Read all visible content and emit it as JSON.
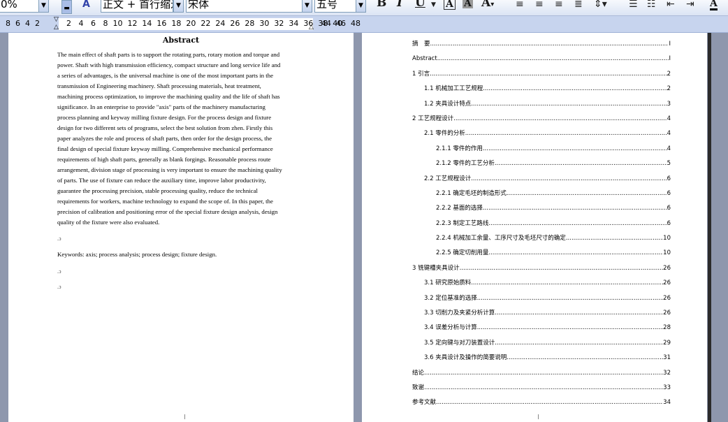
{
  "toolbar": {
    "zoom": "0%",
    "style": "正文 + 首行缩进",
    "font": "宋体",
    "size": "五号",
    "bold": "B",
    "italic": "I",
    "underline": "U",
    "charborder": "A",
    "charshade": "A",
    "fontcolor": "A"
  },
  "ruler": {
    "left_numbers": "8  6  4  2",
    "right_numbers": "2   4   6   8  10  12  14  16  18  20  22  24  26  28  30  32  34  36  38  40",
    "tail_numbers": "44  46  48"
  },
  "abstract": {
    "title": "Abstract",
    "lines": [
      "The main effect of shaft parts is to support the rotating parts, rotary motion and torque and",
      "power. Shaft with high transmission efficiency, compact structure and long service life and",
      "a series of advantages, is the universal machine is one of the most important parts in the",
      "transmission of Engineering machinery. Shaft processing materials, heat treatment,",
      "machining process optimization, to improve the machining quality and the life of shaft has",
      "significance. In an enterprise to provide \"axis\" parts of the machinery manufacturing",
      "process planning and keyway milling fixture design. For the process design and fixture",
      "design for two different sets of programs, select the best solution from zhen. Firstly this",
      "paper analyzes the role and process of shaft parts, then order for the design process, the",
      "final design of special fixture keyway milling. Comprehensive mechanical performance",
      "requirements of high shaft parts, generally as blank forgings. Reasonable process route",
      "arrangement, division stage of processing is very important to ensure the machining quality",
      "of parts. The use of fixture can reduce the auxiliary time, improve labor productivity,",
      "guarantee the processing precision, stable processing quality, reduce the technical",
      "requirements for workers, machine technology to expand the scope of. In this paper, the",
      "precision of calibration and positioning error of the special fixture design analysis, design",
      "quality of the fixture were also evaluated."
    ],
    "keywords": "Keywords: axis; process analysis; process design; fixture design."
  },
  "toc": [
    {
      "label": "摘　要",
      "page": "I",
      "level": 1
    },
    {
      "label": "Abstract",
      "page": "I",
      "level": 1
    },
    {
      "label": "1  引言",
      "page": "2",
      "level": 1
    },
    {
      "label": "1.1 机械加工工艺规程",
      "page": "2",
      "level": 2
    },
    {
      "label": "1.2  夹具设计特点",
      "page": "3",
      "level": 2
    },
    {
      "label": "2  工艺规程设计",
      "page": "4",
      "level": 1
    },
    {
      "label": "2.1  零件的分析",
      "page": "4",
      "level": 2
    },
    {
      "label": "2.1.1  零件的作用",
      "page": "4",
      "level": 3
    },
    {
      "label": "2.1.2  零件的工艺分析",
      "page": "5",
      "level": 3
    },
    {
      "label": "2.2  工艺规程设计",
      "page": "6",
      "level": 2
    },
    {
      "label": "2.2.1  确定毛坯的制造形式",
      "page": "6",
      "level": 3
    },
    {
      "label": "2.2.2  基面的选择",
      "page": "6",
      "level": 3
    },
    {
      "label": "2.2.3  制定工艺路线",
      "page": "6",
      "level": 3
    },
    {
      "label": "2.2.4  机械加工余量、工序尺寸及毛坯尺寸的确定",
      "page": "10",
      "level": 3
    },
    {
      "label": "2.2.5  确定切削用量",
      "page": "10",
      "level": 3
    },
    {
      "label": "3  铣键槽夹具设计",
      "page": "26",
      "level": 1
    },
    {
      "label": "3.1 研究原始质料",
      "page": "26",
      "level": 2
    },
    {
      "label": "3.2 定位基准的选择",
      "page": "26",
      "level": 2
    },
    {
      "label": "3.3  切削力及夹紧分析计算",
      "page": "26",
      "level": 2
    },
    {
      "label": "3.4  误差分析与计算",
      "page": "28",
      "level": 2
    },
    {
      "label": "3.5  定向键与对刀装置设计",
      "page": "29",
      "level": 2
    },
    {
      "label": "3.6  夹具设计及操作的简要说明",
      "page": "31",
      "level": 2
    },
    {
      "label": "结论",
      "page": "32",
      "level": 1
    },
    {
      "label": "致谢",
      "page": "33",
      "level": 1
    },
    {
      "label": "参考文献",
      "page": "34",
      "level": 1
    }
  ]
}
